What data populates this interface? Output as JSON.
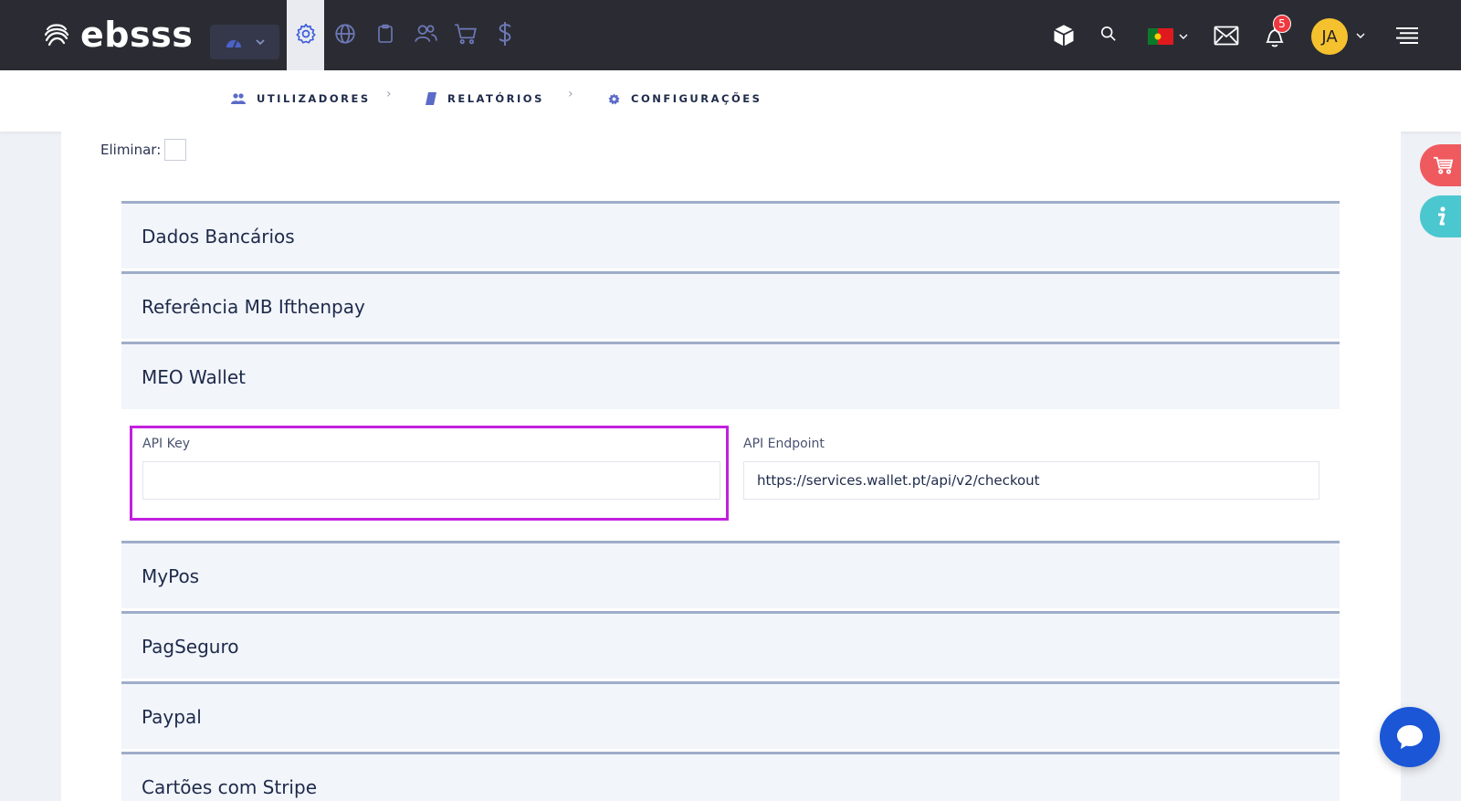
{
  "app": {
    "logo_text": "ebsss"
  },
  "header": {
    "notification_count": "5",
    "avatar_initials": "JA"
  },
  "breadcrumb": [
    {
      "label": "UTILIZADORES",
      "icon": "users-icon"
    },
    {
      "label": "RELATÓRIOS",
      "icon": "book-icon"
    },
    {
      "label": "CONFIGURAÇÕES",
      "icon": "gear-icon"
    }
  ],
  "form": {
    "eliminar_label": "Eliminar:",
    "sections": [
      {
        "title": "Dados Bancários"
      },
      {
        "title": "Referência MB Ifthenpay"
      },
      {
        "title": "MEO Wallet"
      },
      {
        "title": "MyPos"
      },
      {
        "title": "PagSeguro"
      },
      {
        "title": "Paypal"
      },
      {
        "title": "Cartões com Stripe"
      }
    ],
    "meo_wallet": {
      "api_key_label": "API Key",
      "api_key_value": "",
      "api_endpoint_label": "API Endpoint",
      "api_endpoint_value": "https://services.wallet.pt/api/v2/checkout"
    }
  },
  "colors": {
    "topbar": "#2b2c33",
    "accent": "#3b5bdb",
    "highlight": "#c31fe0",
    "badge": "#f0383f",
    "avatar": "#f5c12e"
  }
}
